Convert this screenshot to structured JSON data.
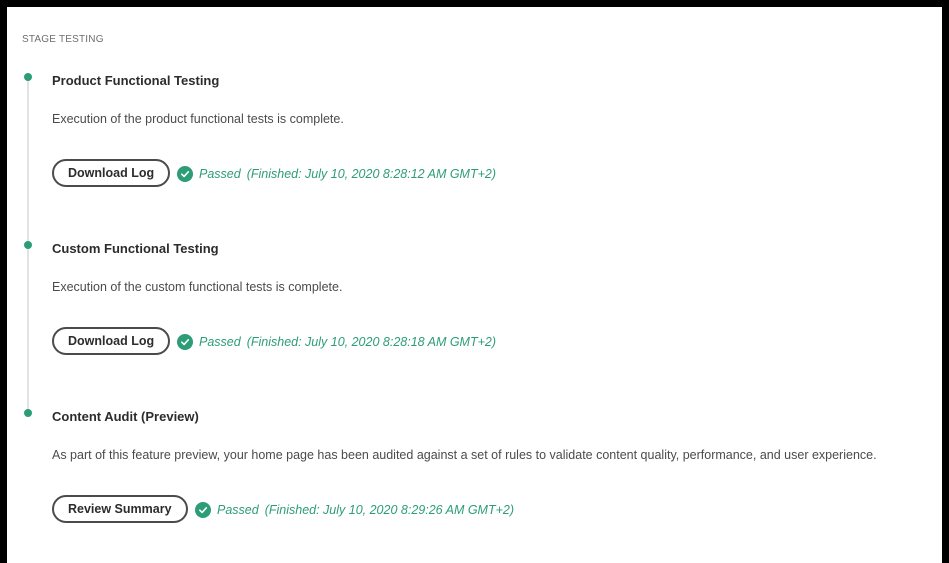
{
  "section_title": "STAGE TESTING",
  "colors": {
    "success": "#2d9d78",
    "text": "#2c2c2c",
    "muted": "#6e6e6e"
  },
  "steps": [
    {
      "title": "Product Functional Testing",
      "description": "Execution of the product functional tests is complete.",
      "button_label": "Download Log",
      "status": "Passed",
      "finished": "(Finished: July 10, 2020 8:28:12 AM GMT+2)"
    },
    {
      "title": "Custom Functional Testing",
      "description": "Execution of the custom functional tests is complete.",
      "button_label": "Download Log",
      "status": "Passed",
      "finished": "(Finished: July 10, 2020 8:28:18 AM GMT+2)"
    },
    {
      "title": "Content Audit (Preview)",
      "description": "As part of this feature preview, your home page has been audited against a set of rules to validate content quality, performance, and user experience.",
      "button_label": "Review Summary",
      "status": "Passed",
      "finished": "(Finished: July 10, 2020 8:29:26 AM GMT+2)"
    }
  ],
  "icons": {
    "timeline_dot": "status-dot-icon",
    "passed": "check-circle-icon"
  }
}
